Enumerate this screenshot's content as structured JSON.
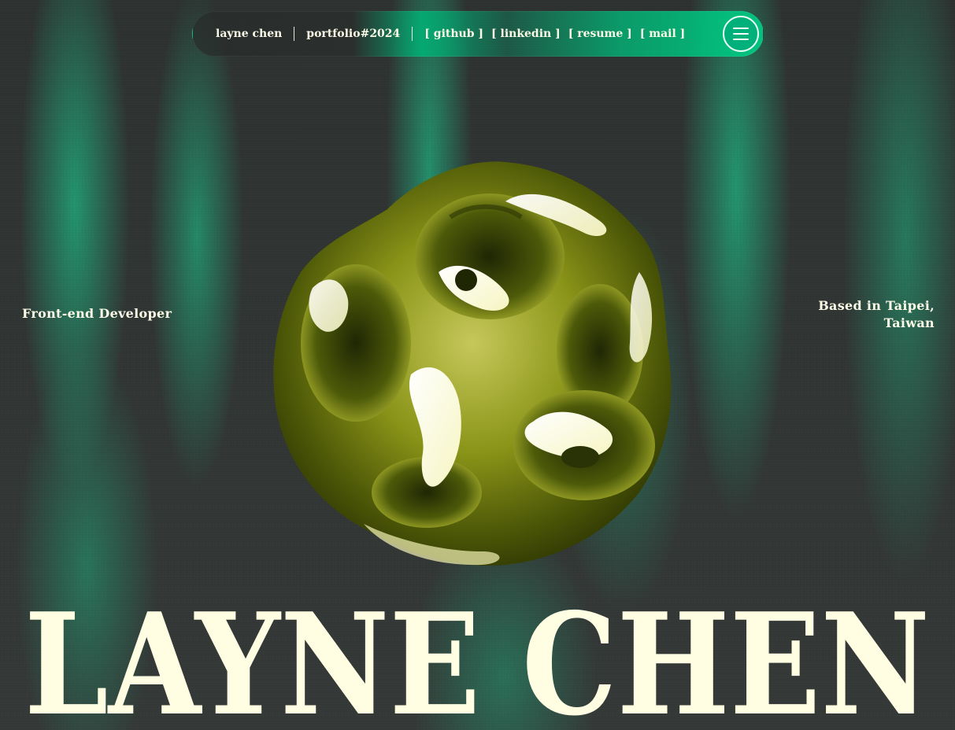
{
  "nav": {
    "name": "layne chen",
    "project": "portfolio#2024",
    "links": [
      {
        "label": "[ github ]"
      },
      {
        "label": "[ linkedin ]"
      },
      {
        "label": "[ resume ]"
      },
      {
        "label": "[ mail ]"
      }
    ],
    "menu_icon": "hamburger-menu-icon"
  },
  "intro": {
    "role": "Front-end Developer",
    "location_line1": "Based in Taipei,",
    "location_line2": "Taiwan"
  },
  "hero": {
    "title": "LAYNE CHEN"
  },
  "colors": {
    "background": "#2f3331",
    "accent_green": "#00b07a",
    "text_cream": "#fbfbe8",
    "hero_fill": "#fffde2",
    "blob_olive": "#8a9418"
  },
  "decor": {
    "blob_icon": "chrome-blob-3d-object"
  }
}
